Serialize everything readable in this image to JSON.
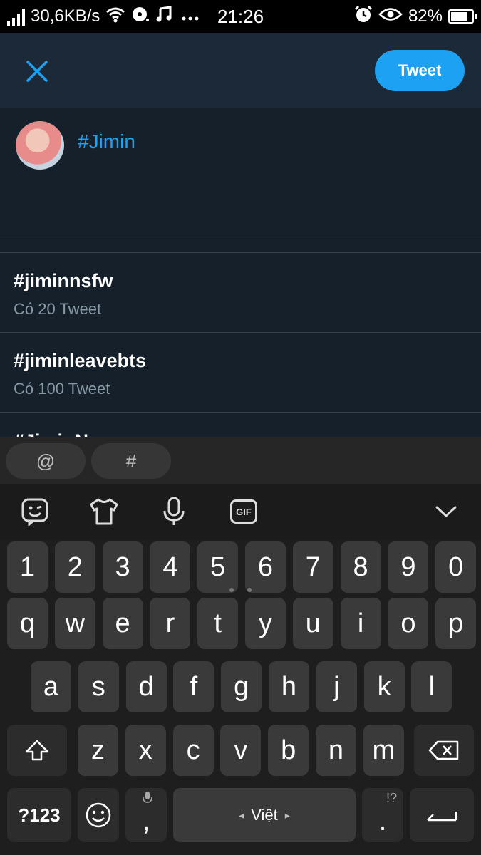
{
  "status_bar": {
    "speed": "30,6KB/s",
    "time": "21:26",
    "battery": "82%",
    "battery_level": 0.82,
    "icons": [
      "signal-icon",
      "wifi-icon",
      "music-disc-icon",
      "music-note-icon",
      "more-dots-icon",
      "alarm-icon",
      "eye-icon",
      "battery-icon"
    ]
  },
  "header": {
    "close_icon": "close-icon",
    "tweet_label": "Tweet"
  },
  "compose": {
    "avatar": "avatar",
    "text": "#Jimin"
  },
  "suggestions": [
    {
      "tag": "#jiminnsfw",
      "count": "Có 20 Tweet"
    },
    {
      "tag": "#jiminleavebts",
      "count": "Có 100 Tweet"
    },
    {
      "tag": "#JiminN",
      "count": ""
    }
  ],
  "keyboard": {
    "chips": [
      "@",
      "#"
    ],
    "toolbar_icons": [
      "sticker-icon",
      "theme-shirt-icon",
      "microphone-icon",
      "gif-icon",
      "chevron-down-icon"
    ],
    "gif_label": "GIF",
    "number_row": [
      "1",
      "2",
      "3",
      "4",
      "5",
      "6",
      "7",
      "8",
      "9",
      "0"
    ],
    "row1": [
      "q",
      "w",
      "e",
      "r",
      "t",
      "y",
      "u",
      "i",
      "o",
      "p"
    ],
    "row2": [
      "a",
      "s",
      "d",
      "f",
      "g",
      "h",
      "j",
      "k",
      "l"
    ],
    "row3": [
      "z",
      "x",
      "c",
      "v",
      "b",
      "n",
      "m"
    ],
    "symbols_label": "?123",
    "comma": ",",
    "space_label": "Việt",
    "period": ".",
    "period_hint": "!?",
    "colors": {
      "accent": "#1da1f2",
      "background": "#15202b",
      "header": "#1c2938",
      "muted": "#8899a6"
    }
  }
}
